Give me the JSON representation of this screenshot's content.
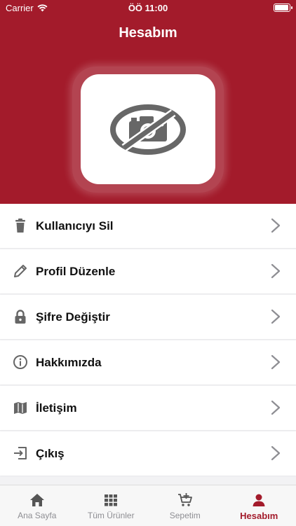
{
  "status_bar": {
    "carrier": "Carrier",
    "time": "ÖÖ 11:00",
    "battery_level": 0.95
  },
  "header": {
    "title": "Hesabım",
    "avatar_placeholder_icon": "no-camera-icon"
  },
  "colors": {
    "brand": "#a31b2b",
    "tab_inactive": "#8e8e93",
    "icon_gray": "#666666"
  },
  "menu": {
    "items": [
      {
        "label": "Kullanıcıyı Sil",
        "icon": "trash-icon"
      },
      {
        "label": "Profil Düzenle",
        "icon": "pencil-icon"
      },
      {
        "label": "Şifre Değiştir",
        "icon": "lock-icon"
      },
      {
        "label": "Hakkımızda",
        "icon": "info-icon"
      },
      {
        "label": "İletişim",
        "icon": "map-icon"
      },
      {
        "label": "Çıkış",
        "icon": "logout-icon"
      }
    ]
  },
  "tabbar": {
    "tabs": [
      {
        "label": "Ana Sayfa",
        "icon": "home-icon",
        "active": false
      },
      {
        "label": "Tüm Ürünler",
        "icon": "grid-icon",
        "active": false
      },
      {
        "label": "Sepetim",
        "icon": "cart-icon",
        "active": false
      },
      {
        "label": "Hesabım",
        "icon": "person-icon",
        "active": true
      }
    ]
  }
}
